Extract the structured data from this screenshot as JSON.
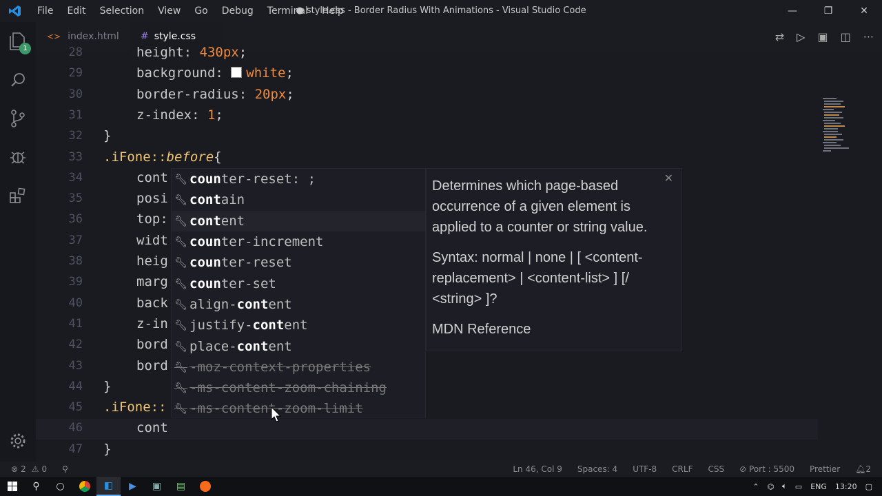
{
  "app": {
    "window_title": "● style.css - Border Radius With Animations - Visual Studio Code",
    "menu": [
      "File",
      "Edit",
      "Selection",
      "View",
      "Go",
      "Debug",
      "Terminal",
      "Help"
    ]
  },
  "activity": {
    "badge": "1"
  },
  "tabs": [
    {
      "label": "index.html",
      "icon": "html-icon"
    },
    {
      "label": "style.css",
      "icon": "css-icon",
      "dirty": true
    }
  ],
  "lines": [
    {
      "n": "28",
      "code": [
        [
          "prop",
          "height: "
        ],
        [
          "val",
          "430px"
        ],
        [
          "brace",
          ";"
        ]
      ]
    },
    {
      "n": "29",
      "code": [
        [
          "prop",
          "background: "
        ],
        [
          "val",
          "white"
        ],
        [
          "brace",
          ";"
        ]
      ]
    },
    {
      "n": "30",
      "code": [
        [
          "prop",
          "border-radius: "
        ],
        [
          "val",
          "20px"
        ],
        [
          "brace",
          ";"
        ]
      ]
    },
    {
      "n": "31",
      "code": [
        [
          "prop",
          "z-index: "
        ],
        [
          "val",
          "1"
        ],
        [
          "brace",
          ";"
        ]
      ]
    },
    {
      "n": "32",
      "code": [
        [
          "brace",
          "}"
        ]
      ]
    },
    {
      "n": "33",
      "code": [
        [
          "sel",
          ".iFone::"
        ],
        [
          "pseudo",
          "before"
        ],
        [
          "brace",
          "{"
        ]
      ]
    },
    {
      "n": "34",
      "code": [
        [
          "prop",
          "cont"
        ]
      ]
    },
    {
      "n": "35",
      "code": [
        [
          "prop",
          "posi"
        ]
      ]
    },
    {
      "n": "36",
      "code": [
        [
          "prop",
          "top:"
        ]
      ]
    },
    {
      "n": "37",
      "code": [
        [
          "prop",
          "widt"
        ]
      ]
    },
    {
      "n": "38",
      "code": [
        [
          "prop",
          "heig"
        ]
      ]
    },
    {
      "n": "39",
      "code": [
        [
          "prop",
          "marg"
        ]
      ]
    },
    {
      "n": "40",
      "code": [
        [
          "prop",
          "back"
        ]
      ]
    },
    {
      "n": "41",
      "code": [
        [
          "prop",
          "z-in"
        ]
      ]
    },
    {
      "n": "42",
      "code": [
        [
          "prop",
          "bord"
        ]
      ]
    },
    {
      "n": "43",
      "code": [
        [
          "prop",
          "bord"
        ]
      ]
    },
    {
      "n": "44",
      "code": [
        [
          "brace",
          "}"
        ]
      ]
    },
    {
      "n": "45",
      "code": [
        [
          "sel",
          ".iFone::"
        ]
      ]
    },
    {
      "n": "46",
      "code": [
        [
          "prop",
          "cont"
        ]
      ]
    },
    {
      "n": "47",
      "code": [
        [
          "brace",
          "}"
        ]
      ]
    }
  ],
  "suggestions": [
    {
      "pre": "",
      "match": "coun",
      "post": "ter-reset: ;",
      "deprecated": false
    },
    {
      "pre": "",
      "match": "cont",
      "post": "ain",
      "deprecated": false
    },
    {
      "pre": "",
      "match": "cont",
      "post": "ent",
      "deprecated": false,
      "selected": true
    },
    {
      "pre": "",
      "match": "coun",
      "post": "ter-increment",
      "deprecated": false
    },
    {
      "pre": "",
      "match": "coun",
      "post": "ter-reset",
      "deprecated": false
    },
    {
      "pre": "",
      "match": "coun",
      "post": "ter-set",
      "deprecated": false
    },
    {
      "pre": "align-",
      "match": "cont",
      "post": "ent",
      "deprecated": false
    },
    {
      "pre": "justify-",
      "match": "cont",
      "post": "ent",
      "deprecated": false
    },
    {
      "pre": "place-",
      "match": "cont",
      "post": "ent",
      "deprecated": false
    },
    {
      "pre": "-moz-context-properties",
      "match": "",
      "post": "",
      "deprecated": true
    },
    {
      "pre": "-ms-content-zoom-chaining",
      "match": "",
      "post": "",
      "deprecated": true
    },
    {
      "pre": "-ms-content-zoom-limit",
      "match": "",
      "post": "",
      "deprecated": true
    }
  ],
  "details": {
    "description": "Determines which page-based occurrence of a given element is applied to a counter or string value.",
    "syntax": "Syntax: normal | none | [ <content-replacement> | <content-list> ] [/ <string> ]?",
    "reference": "MDN Reference"
  },
  "statusbar": {
    "errors": "2",
    "warnings": "0",
    "position": "Ln 46, Col 9",
    "spaces": "Spaces: 4",
    "encoding": "UTF-8",
    "eol": "CRLF",
    "language": "CSS",
    "port": "Port : 5500",
    "formatter": "Prettier",
    "notifications": "2"
  },
  "taskbar": {
    "lang": "ENG",
    "time": "13:20"
  }
}
